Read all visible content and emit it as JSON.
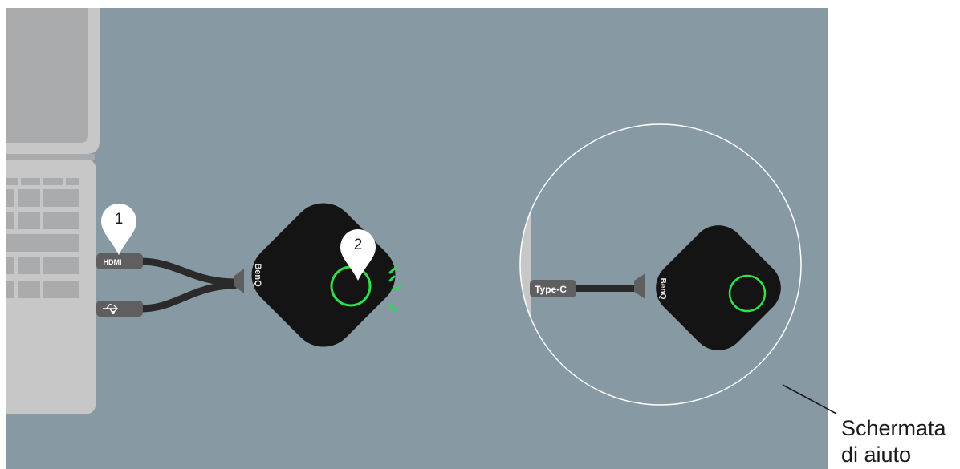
{
  "badges": {
    "step1": "1",
    "step2": "2"
  },
  "ports": {
    "hdmi": "HDMI",
    "usb_c": "Type-C"
  },
  "brand": {
    "dongle_left": "BenQ",
    "dongle_right": "BenQ"
  },
  "callout": {
    "line1": "Schermata",
    "line2": "di aiuto"
  },
  "colors": {
    "background": "#879aa4",
    "laptop": "#c7c7c7",
    "laptop_shadow": "#a8aaab",
    "dongle": "#141414",
    "led_ring": "#2ee04a",
    "cable": "#2a2a2a",
    "connector": "#5f5f5f",
    "zoom_circle": "#ffffff"
  }
}
